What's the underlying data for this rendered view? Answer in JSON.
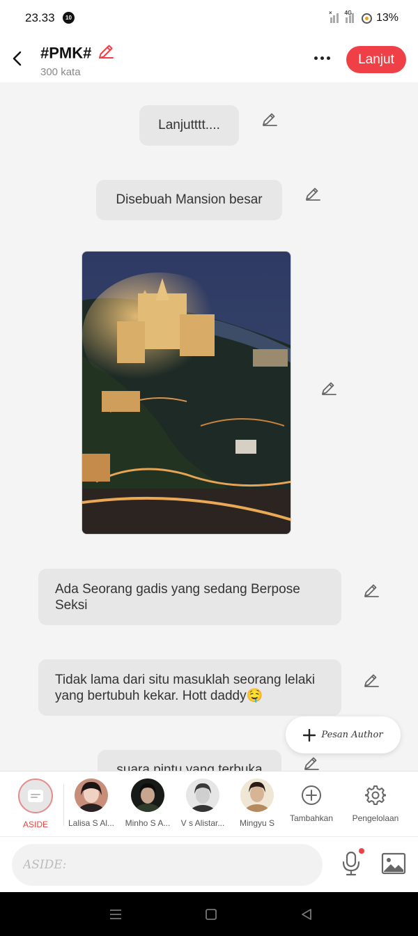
{
  "status_bar": {
    "time": "23.33",
    "notification_count": "10",
    "battery": "13%",
    "network": "4G"
  },
  "header": {
    "title": "#PMK#",
    "word_count": "300 kata",
    "continue_label": "Lanjut"
  },
  "messages": [
    {
      "text": "Lanjutttt...."
    },
    {
      "text": "Disebuah Mansion besar"
    },
    {
      "image": "castle-mansion-night-photo"
    },
    {
      "text": "Ada Seorang gadis yang sedang Berpose Seksi"
    },
    {
      "text": "Tidak lama dari situ masuklah seorang lelaki yang bertubuh kekar. Hott daddy🤤"
    },
    {
      "text": "suara pintu yang terbuka"
    }
  ],
  "fab": {
    "label": "Pesan Author"
  },
  "characters": [
    {
      "name": "ASIDE"
    },
    {
      "name": "Lalisa S Al..."
    },
    {
      "name": "Minho S A..."
    },
    {
      "name": "V s Alistar..."
    },
    {
      "name": "Mingyu S"
    },
    {
      "name": "Tambahkan"
    },
    {
      "name": "Pengelolaan"
    }
  ],
  "input": {
    "placeholder": "ASIDE:"
  },
  "colors": {
    "accent": "#ef4048",
    "bubble": "#e7e7e7",
    "background": "#f4f4f4"
  }
}
